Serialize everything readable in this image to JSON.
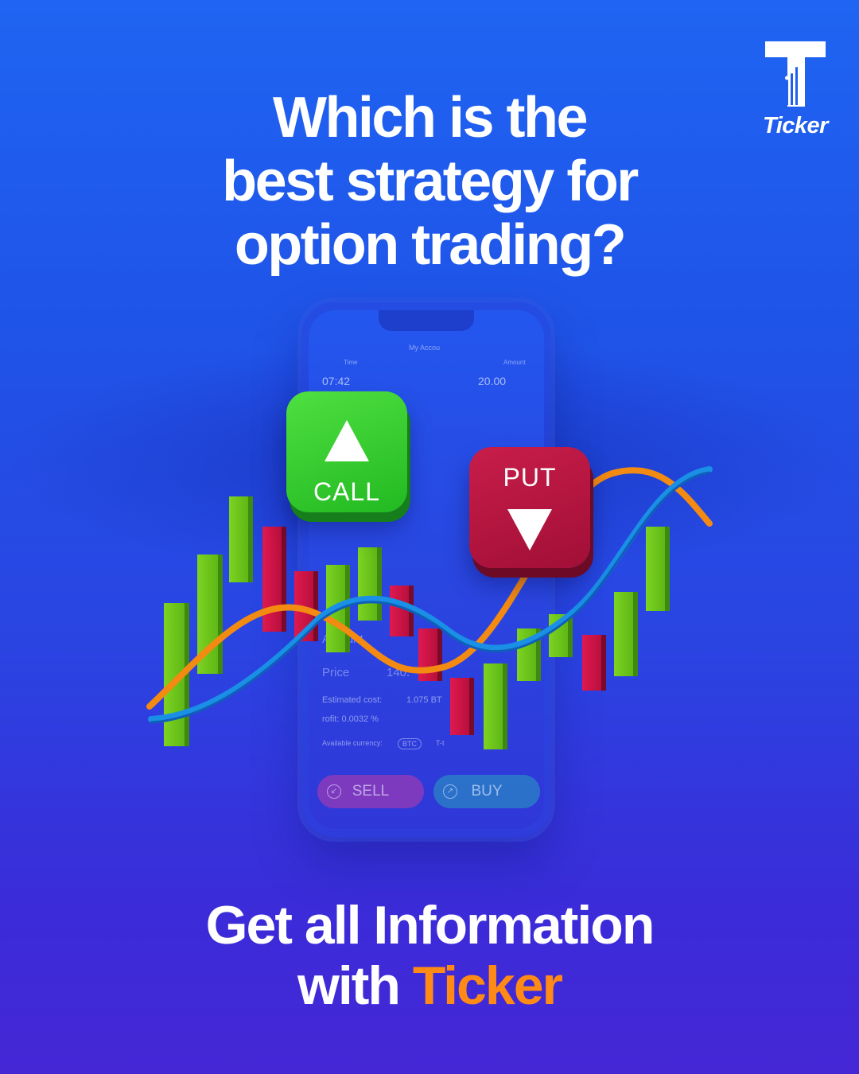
{
  "headline": {
    "line1": "Which is the",
    "line2": "best strategy for",
    "line3": "option trading?"
  },
  "logo": {
    "word": "Ticker"
  },
  "phone": {
    "title": "My Accou",
    "time_label": "Time",
    "time_value": "07:42",
    "amount_label": "Amount",
    "amount_value": "20.00",
    "amount_row": "Amount",
    "price_row": "Price",
    "price_value": "140.",
    "est_cost": "Estimated cost:",
    "est_value": "1.075  BT",
    "profit": "rofit: 0.0032 %",
    "avail": "Available currency:",
    "tag_btc": "BTC",
    "tag_other": "T-t",
    "sell_label": "SELL",
    "buy_label": "BUY"
  },
  "buttons": {
    "call_label": "CALL",
    "put_label": "PUT"
  },
  "footer": {
    "line1": "Get all Information",
    "line2_prefix": "with ",
    "line2_brand": "Ticker"
  },
  "colors": {
    "brand_orange": "#ff8a16",
    "call_green": "#2fc92a",
    "put_red": "#b5163f"
  },
  "icons": {
    "call": "triangle-up-icon",
    "put": "triangle-down-icon",
    "sell": "arrow-down-left-circle-icon",
    "buy": "arrow-up-right-circle-icon"
  }
}
